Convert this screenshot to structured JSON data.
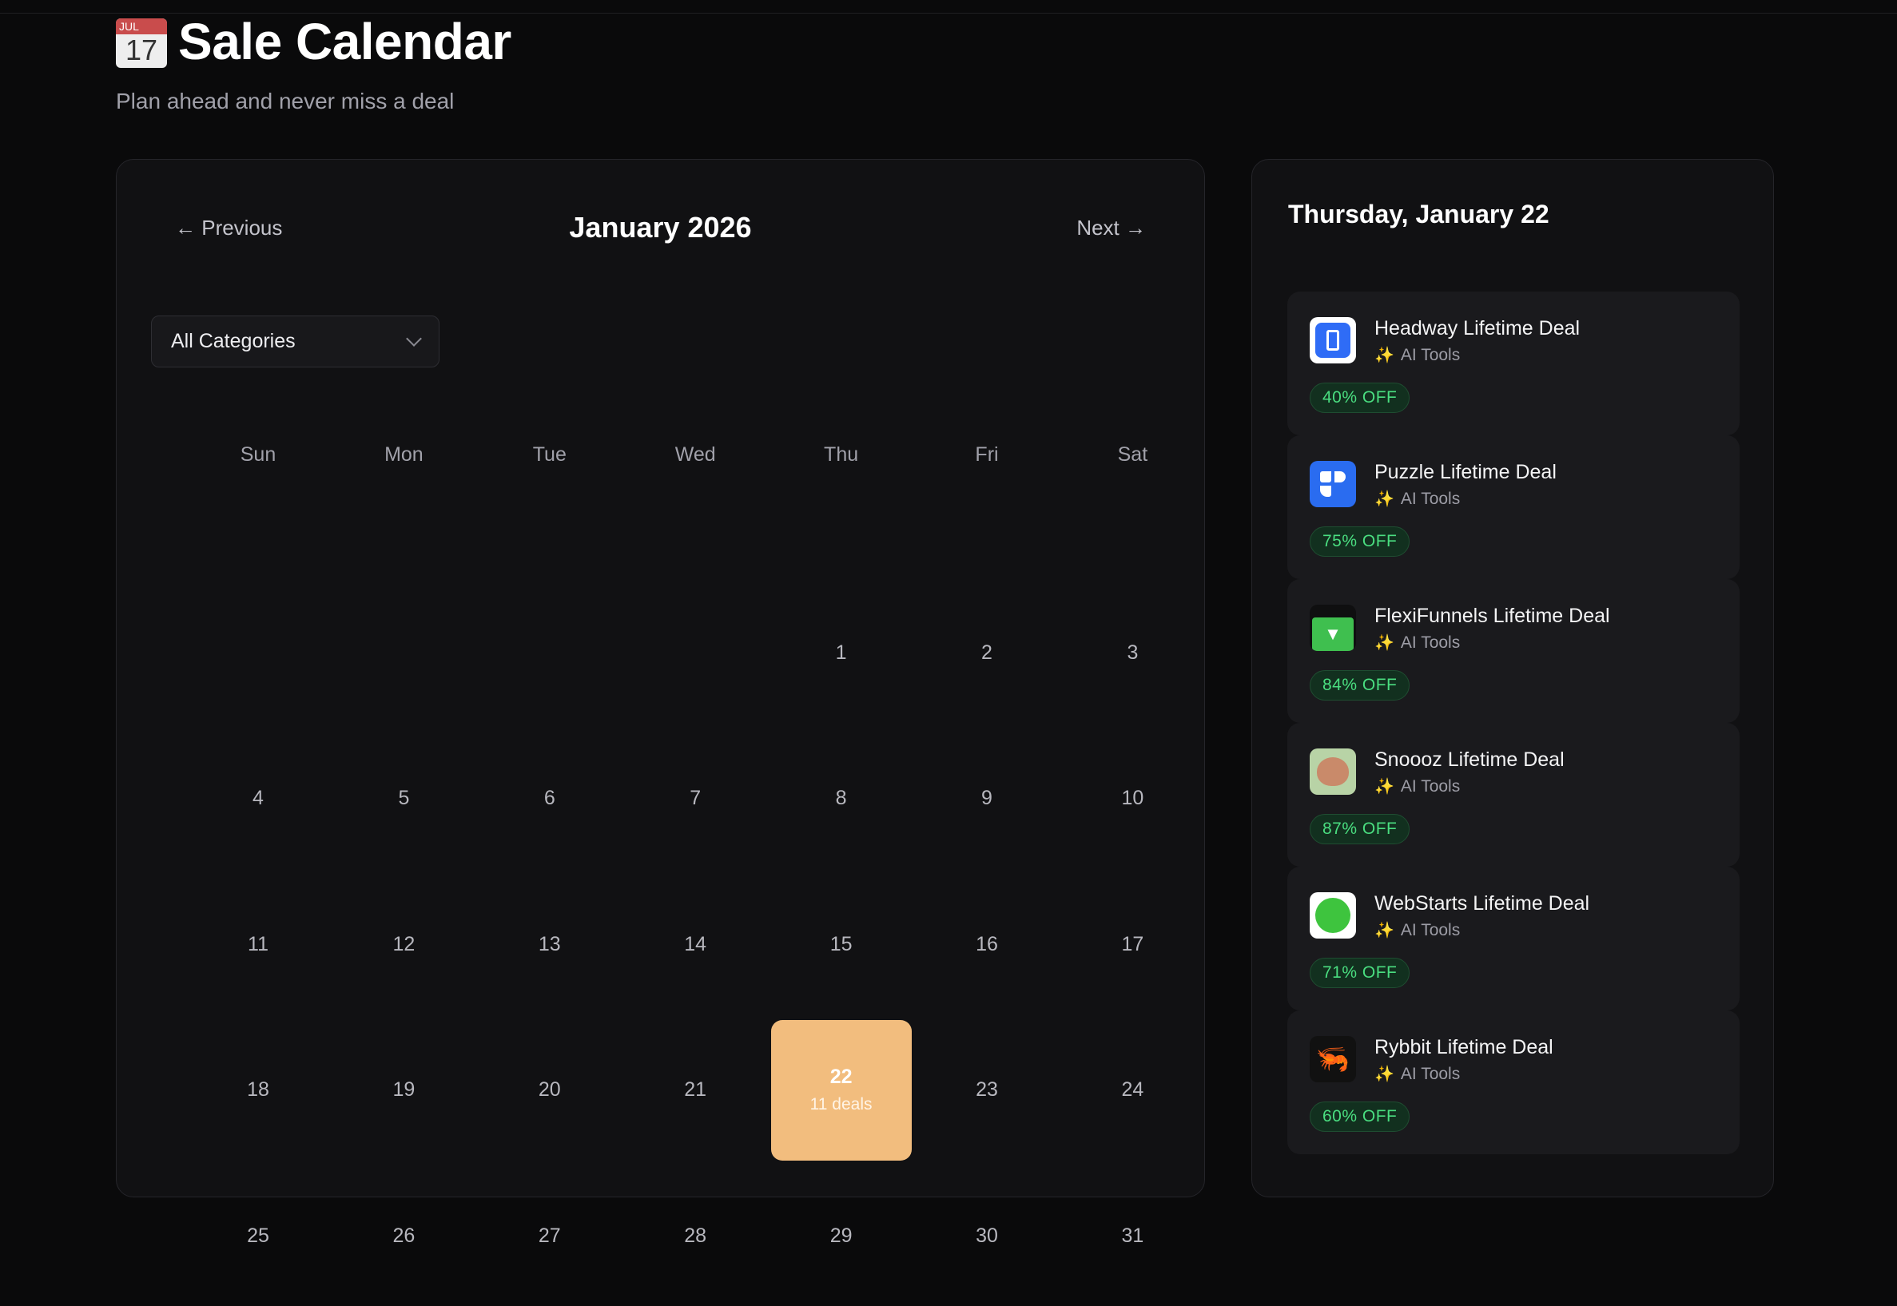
{
  "page": {
    "title": "Sale Calendar",
    "subtitle": "Plan ahead and never miss a deal",
    "emoji_month": "JUL",
    "emoji_day": "17"
  },
  "calendar": {
    "prev_label": "← Previous",
    "next_label": "Next →",
    "month_title": "January 2026",
    "category_select": "All Categories",
    "weekdays": [
      "Sun",
      "Mon",
      "Tue",
      "Wed",
      "Thu",
      "Fri",
      "Sat"
    ],
    "first_weekday_index": 4,
    "visible_days": [
      "1",
      "2",
      "3",
      "4",
      "5",
      "6",
      "7",
      "8",
      "9",
      "10",
      "11",
      "12",
      "13",
      "14",
      "15",
      "16",
      "17",
      "18",
      "19",
      "20",
      "21",
      "22",
      "23",
      "24",
      "25",
      "26",
      "27",
      "28",
      "29",
      "30",
      "31"
    ],
    "selected_day": "22",
    "selected_day_deals": "11 deals",
    "accent_color": "#f2bd7e"
  },
  "sidebar": {
    "title": "Thursday, January 22",
    "deals": [
      {
        "name": "Headway Lifetime Deal",
        "category": "AI Tools",
        "discount": "40% OFF",
        "icon": "headway-logo"
      },
      {
        "name": "Puzzle Lifetime Deal",
        "category": "AI Tools",
        "discount": "75% OFF",
        "icon": "puzzle-logo"
      },
      {
        "name": "FlexiFunnels Lifetime Deal",
        "category": "AI Tools",
        "discount": "84% OFF",
        "icon": "flexifunnels-logo"
      },
      {
        "name": "Snoooz Lifetime Deal",
        "category": "AI Tools",
        "discount": "87% OFF",
        "icon": "snoooz-logo"
      },
      {
        "name": "WebStarts Lifetime Deal",
        "category": "AI Tools",
        "discount": "71% OFF",
        "icon": "webstarts-logo"
      },
      {
        "name": "Rybbit Lifetime Deal",
        "category": "AI Tools",
        "discount": "60% OFF",
        "icon": "rybbit-logo"
      }
    ],
    "badge_color": "#4ade80"
  }
}
